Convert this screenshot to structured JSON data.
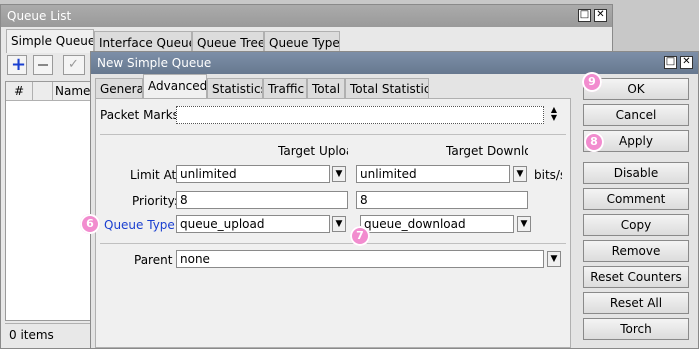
{
  "queue_list": {
    "title": "Queue List",
    "tabs": [
      "Simple Queues",
      "Interface Queues",
      "Queue Tree",
      "Queue Types"
    ],
    "columns": [
      "#",
      "Name"
    ],
    "status": "0 items"
  },
  "dialog": {
    "title": "New Simple Queue",
    "tabs": [
      "General",
      "Advanced",
      "Statistics",
      "Traffic",
      "Total",
      "Total Statistics"
    ],
    "packet_marks_label": "Packet Marks",
    "target_upload_header": "Target Upload",
    "target_download_header": "Target Download",
    "limit_at_label": "Limit At",
    "limit_at_upload": "unlimited",
    "limit_at_download": "unlimited",
    "unit": "bits/s",
    "priority_label": "Priority:",
    "priority_upload": "8",
    "priority_download": "8",
    "queue_type_label": "Queue Type",
    "queue_type_upload": "queue_upload",
    "queue_type_download": "queue_download",
    "parent_label": "Parent",
    "parent_value": "none"
  },
  "buttons": {
    "ok": "OK",
    "cancel": "Cancel",
    "apply": "Apply",
    "disable": "Disable",
    "comment": "Comment",
    "copy": "Copy",
    "remove": "Remove",
    "reset_counters": "Reset Counters",
    "reset_all_counters": "Reset All Counters",
    "torch": "Torch"
  },
  "markers": {
    "m6": "6",
    "m7": "7",
    "m8": "8",
    "m9": "9"
  },
  "colors": {
    "marker": "#f28ccf",
    "link_blue": "#1a3fd0",
    "title_active": "#7d8fa8"
  }
}
